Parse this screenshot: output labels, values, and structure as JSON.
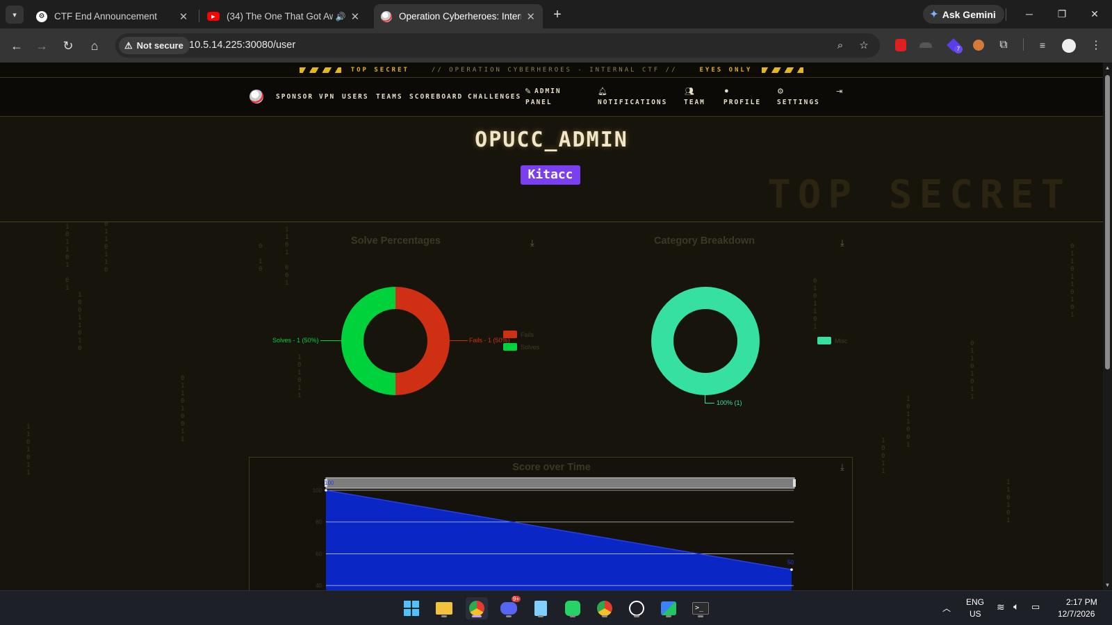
{
  "browser": {
    "tabs": [
      {
        "title": "CTF End Announcement",
        "active": false
      },
      {
        "title": "(34) The One That Got Away",
        "active": false
      },
      {
        "title": "Operation Cyberheroes: Internal",
        "active": true
      }
    ],
    "ask_gemini": "Ask Gemini",
    "security_chip": "Not secure",
    "url": "10.5.14.225:30080/user",
    "extension_badge": "7"
  },
  "banner": {
    "top_secret": "TOP SECRET",
    "operation": "// OPERATION CYBERHEROES - INTERNAL CTF //",
    "eyes_only": "EYES ONLY"
  },
  "nav": {
    "sponsor": "SPONSOR",
    "vpn": "VPN",
    "users": "USERS",
    "teams": "TEAMS",
    "scoreboard": "SCOREBOARD",
    "challenges": "CHALLENGES",
    "admin_line1": "ADMIN",
    "admin_line2": "PANEL",
    "notifications": "NOTIFICATIONS",
    "team": "TEAM",
    "profile": "PROFILE",
    "settings": "SETTINGS"
  },
  "profile": {
    "username": "OPUCC_ADMIN",
    "team_badge": "Kitacc",
    "watermark": "TOP SECRET"
  },
  "chart_data": [
    {
      "type": "pie",
      "title": "Solve Percentages",
      "categories": [
        "Fails",
        "Solves"
      ],
      "values": [
        1,
        1
      ],
      "colors": [
        "#cf3014",
        "#00d23c"
      ],
      "data_labels": [
        "Fails - 1 (50%)",
        "Solves - 1 (50%)"
      ],
      "legend": [
        "Fails",
        "Solves"
      ],
      "legend_position": "right"
    },
    {
      "type": "pie",
      "title": "Category Breakdown",
      "categories": [
        "Misc"
      ],
      "values": [
        1
      ],
      "colors": [
        "#35e0a0"
      ],
      "data_labels": [
        "100% (1)"
      ],
      "legend": [
        "Misc"
      ],
      "legend_position": "right"
    },
    {
      "type": "area",
      "title": "Score over Time",
      "x": [
        0,
        1
      ],
      "series": [
        {
          "values": [
            100,
            50
          ]
        }
      ],
      "point_labels": [
        "100",
        "50"
      ],
      "yticks": [
        40,
        60,
        80,
        100
      ],
      "ylim": [
        30,
        100
      ],
      "grid": true,
      "color": "#0a26c4"
    }
  ],
  "taskbar": {
    "lang_line1": "ENG",
    "lang_line2": "US",
    "time": "2:17 PM",
    "date": "12/7/2026",
    "discord_badge": "9+"
  }
}
